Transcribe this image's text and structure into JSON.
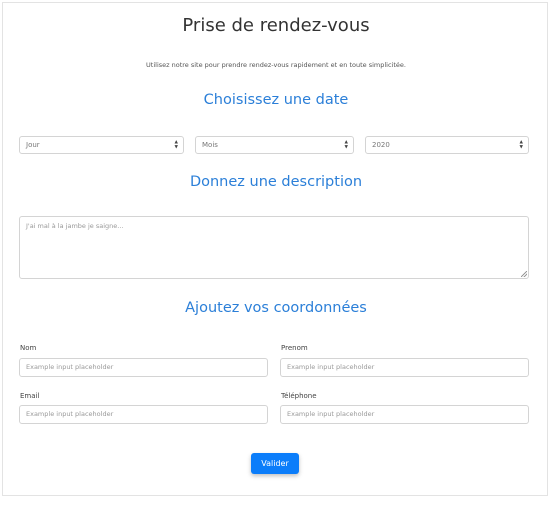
{
  "header": {
    "title": "Prise de rendez-vous",
    "subtitle": "Utilisez notre site pour prendre rendez-vous rapidement et en toute simplicitée."
  },
  "date_section": {
    "title": "Choisissez une date",
    "day_select": "Jour",
    "month_select": "Mois",
    "year_select": "2020"
  },
  "description_section": {
    "title": "Donnez une description",
    "placeholder": "J'ai mal à la jambe je saigne..."
  },
  "contact_section": {
    "title": "Ajoutez vos coordonnées",
    "fields": [
      {
        "label": "Nom",
        "placeholder": "Example input placeholder"
      },
      {
        "label": "Prenom",
        "placeholder": "Example input placeholder"
      },
      {
        "label": "Email",
        "placeholder": "Example input placeholder"
      },
      {
        "label": "Téléphone",
        "placeholder": "Example input placeholder"
      }
    ]
  },
  "submit_label": "Valider",
  "colors": {
    "accent": "#2b7fd8",
    "button": "#0b7dfa"
  },
  "icons": {
    "select_arrow": "chevron-updown-icon"
  }
}
